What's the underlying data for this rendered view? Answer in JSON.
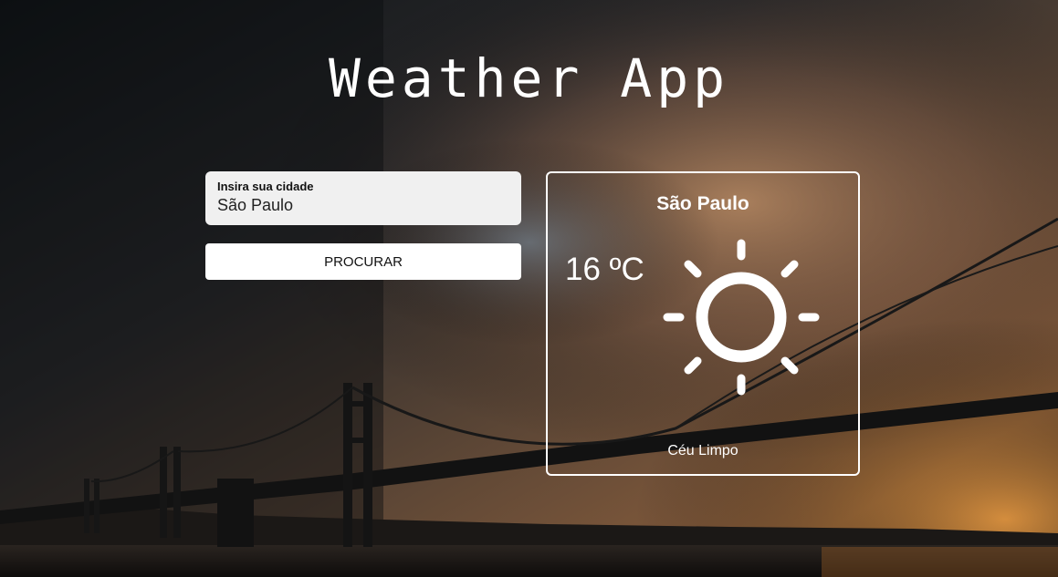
{
  "app": {
    "title": "Weather App"
  },
  "search": {
    "label": "Insira sua cidade",
    "value": "São Paulo",
    "button_label": "PROCURAR"
  },
  "weather": {
    "city": "São Paulo",
    "temperature": "16 ºC",
    "description": "Céu Limpo",
    "icon": "sun-icon"
  },
  "colors": {
    "card_border": "#ffffff",
    "input_bg": "#f0f0f0",
    "button_bg": "#ffffff",
    "text_light": "#ffffff"
  }
}
